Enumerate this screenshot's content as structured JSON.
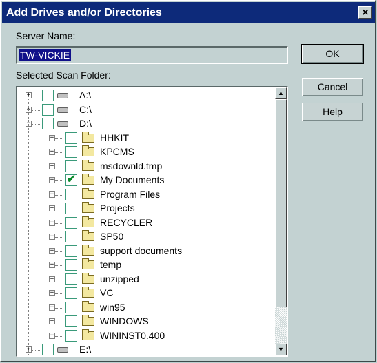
{
  "window": {
    "title": "Add Drives and/or Directories",
    "close_label": "×"
  },
  "labels": {
    "server_name": "Server Name:",
    "scan_folder": "Selected Scan Folder:"
  },
  "server_name": {
    "value": "TW-VICKIE"
  },
  "buttons": {
    "ok": "OK",
    "cancel": "Cancel",
    "help": "Help"
  },
  "tree": {
    "drives_top": [
      {
        "label": "A:\\",
        "expanded": false,
        "checked": false
      },
      {
        "label": "C:\\",
        "expanded": false,
        "checked": false
      },
      {
        "label": "D:\\",
        "expanded": true,
        "checked": false
      }
    ],
    "d_folders": [
      {
        "label": "HHKIT",
        "checked": false
      },
      {
        "label": "KPCMS",
        "checked": false
      },
      {
        "label": "msdownld.tmp",
        "checked": false
      },
      {
        "label": "My Documents",
        "checked": true
      },
      {
        "label": "Program Files",
        "checked": false
      },
      {
        "label": "Projects",
        "checked": false
      },
      {
        "label": "RECYCLER",
        "checked": false
      },
      {
        "label": "SP50",
        "checked": false
      },
      {
        "label": "support documents",
        "checked": false
      },
      {
        "label": "temp",
        "checked": false
      },
      {
        "label": "unzipped",
        "checked": false
      },
      {
        "label": "VC",
        "checked": false
      },
      {
        "label": "win95",
        "checked": false
      },
      {
        "label": "WINDOWS",
        "checked": false
      },
      {
        "label": "WININST0.400",
        "checked": false
      }
    ],
    "drives_bottom": [
      {
        "label": "E:\\",
        "expanded": false,
        "checked": false
      }
    ]
  },
  "scrollbar": {
    "up_glyph": "▲",
    "down_glyph": "▼"
  },
  "glyphs": {
    "plus": "+",
    "minus": "−",
    "check": "✔"
  },
  "colors": {
    "titlebar": "#0d2a7a",
    "dialog_bg": "#c3d2d2",
    "selection": "#10108a",
    "check": "#0a8a2a"
  }
}
